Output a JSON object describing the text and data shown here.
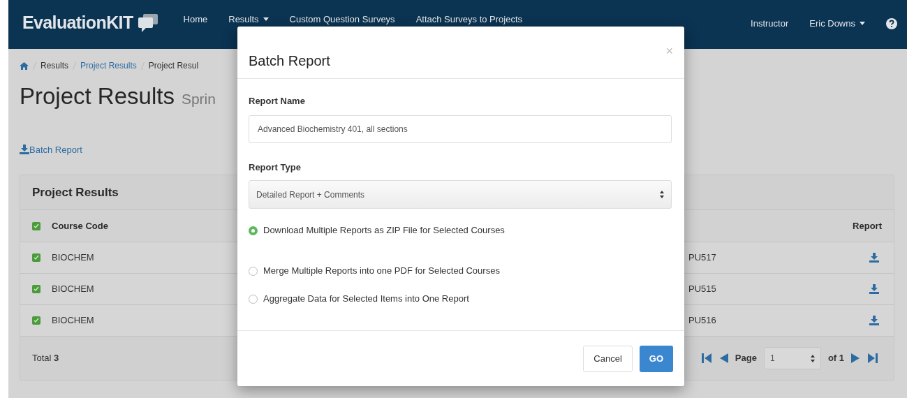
{
  "navbar": {
    "brand": "EvaluationKIT",
    "items": [
      {
        "label": "Home",
        "dropdown": false
      },
      {
        "label": "Results",
        "dropdown": true
      },
      {
        "label": "Custom Question Surveys",
        "dropdown": false
      },
      {
        "label": "Attach Surveys to Projects",
        "dropdown": false
      }
    ],
    "role": "Instructor",
    "user": {
      "label": "Eric Downs",
      "dropdown": true
    }
  },
  "breadcrumb": [
    {
      "label": "Results",
      "link": false
    },
    {
      "label": "Project Results",
      "link": true
    },
    {
      "label": "Project Resul",
      "link": false
    }
  ],
  "page_title": "Project Results",
  "page_subtitle": "Sprin",
  "batch_link": "Batch Report",
  "panel": {
    "title": "Project Results",
    "columns": [
      {
        "label": "Course Code",
        "checked": true
      },
      {
        "label": "Report"
      }
    ],
    "rows": [
      {
        "course_code": "BIOCHEM",
        "column_3": "PU517",
        "checked": true
      },
      {
        "course_code": "BIOCHEM",
        "column_3": "PU515",
        "checked": true
      },
      {
        "course_code": "BIOCHEM",
        "column_3": "PU516",
        "checked": true
      }
    ],
    "total": "Total **3**",
    "pager": {
      "label": "Page",
      "value": "1",
      "of": "of 1"
    }
  },
  "modal": {
    "title": "Batch Report",
    "close": "×",
    "name_label": "Report Name",
    "name_value": "Advanced Biochemistry 401, all sections",
    "type_label": "Report Type",
    "type_value": "Detailed Report + Comments",
    "options": [
      {
        "label": "Download Multiple Reports as ZIP File for Selected Courses",
        "selected": true
      },
      {
        "label": "Merge Multiple Reports into one PDF for Selected Courses",
        "selected": false
      },
      {
        "label": "Aggregate Data for Selected Items into One Report",
        "selected": false
      }
    ],
    "buttons": [
      {
        "label": "Cancel",
        "kind": "default"
      },
      {
        "label": "GO",
        "kind": "primary"
      }
    ]
  }
}
